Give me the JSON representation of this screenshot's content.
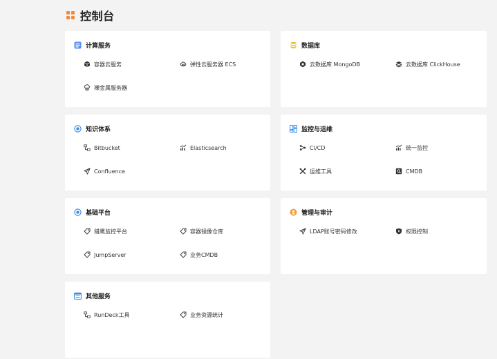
{
  "header": {
    "title": "控制台"
  },
  "colors": {
    "accent": "#f08a3c",
    "blue": "#3a8ee6",
    "yellow": "#f2c230",
    "orange": "#f29d38"
  },
  "cards": {
    "compute": {
      "title": "计算服务",
      "items": [
        "容器云服务",
        "弹性云服务器 ECS",
        "裸金属服务器"
      ]
    },
    "database": {
      "title": "数据库",
      "items": [
        "云数据库 MongoDB",
        "云数据库 ClickHouse"
      ]
    },
    "knowledge": {
      "title": "知识体系",
      "items": [
        "Bitbucket",
        "Elasticsearch",
        "Confluence"
      ]
    },
    "monitor": {
      "title": "监控与运维",
      "items": [
        "CI/CD",
        "统一监控",
        "运维工具",
        "CMDB"
      ]
    },
    "platform": {
      "title": "基础平台",
      "items": [
        "猎鹰监控平台",
        "容器镜像仓库",
        "JumpServer",
        "业务CMDB"
      ]
    },
    "audit": {
      "title": "管理与审计",
      "items": [
        "LDAP账号密码修改",
        "权限控制"
      ]
    },
    "other": {
      "title": "其他服务",
      "items": [
        "RunDeck工具",
        "业务资源统计"
      ]
    }
  }
}
